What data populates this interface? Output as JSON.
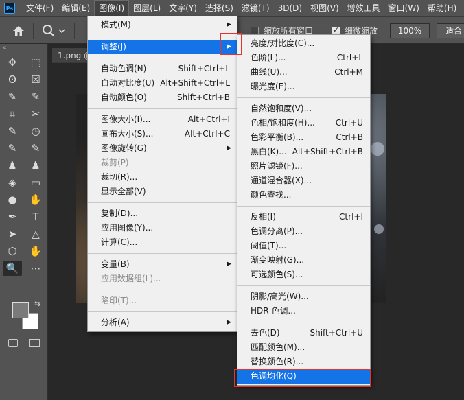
{
  "menubar": {
    "logo": "Ps",
    "items": [
      "文件(F)",
      "编辑(E)",
      "图像(I)",
      "图层(L)",
      "文字(Y)",
      "选择(S)",
      "滤镜(T)",
      "3D(D)",
      "视图(V)",
      "增效工具",
      "窗口(W)",
      "帮助(H)"
    ],
    "active_index": 2
  },
  "options": {
    "resize_all_windows": "缩放所有窗口",
    "scrubby_zoom": "细微缩放",
    "zoom_value": "100%",
    "fit_label": "适合"
  },
  "tools": {
    "header": "«",
    "icons": [
      "move-icon",
      "marquee-icon",
      "lasso-icon",
      "frame-icon",
      "quick-select-icon",
      "eyedropper-icon",
      "crop-icon",
      "patch-icon",
      "heal-icon",
      "crop-frame-icon",
      "brush-icon",
      "color-sampler-icon",
      "clone-stamp-icon",
      "history-brush-icon",
      "eraser-icon",
      "gradient-icon",
      "blur-icon",
      "dodge-icon",
      "pen-icon",
      "type-icon",
      "path-select-icon",
      "shape-icon",
      "ellipse-icon",
      "hand-icon",
      "zoom-icon",
      "more-icon"
    ],
    "glyphs": [
      "✥",
      "⬚",
      "ʘ",
      "☒",
      "✎",
      "✎",
      "⌗",
      "✂",
      "✎",
      "◷",
      "✎",
      "✎",
      "♟",
      "♟",
      "◈",
      "▭",
      "●",
      "✋",
      "✒",
      "T",
      "➤",
      "△",
      "⬡",
      "✋",
      "🔍",
      "⋯"
    ]
  },
  "document": {
    "tab": "1.png @"
  },
  "image_menu": {
    "items": [
      {
        "label": "模式(M)",
        "shortcut": "",
        "submenu": true
      },
      {
        "sep": true
      },
      {
        "label": "调整(J)",
        "shortcut": "",
        "submenu": true,
        "highlighted": true
      },
      {
        "sep": true
      },
      {
        "label": "自动色调(N)",
        "shortcut": "Shift+Ctrl+L"
      },
      {
        "label": "自动对比度(U)",
        "shortcut": "Alt+Shift+Ctrl+L"
      },
      {
        "label": "自动颜色(O)",
        "shortcut": "Shift+Ctrl+B"
      },
      {
        "sep": true
      },
      {
        "label": "图像大小(I)...",
        "shortcut": "Alt+Ctrl+I"
      },
      {
        "label": "画布大小(S)...",
        "shortcut": "Alt+Ctrl+C"
      },
      {
        "label": "图像旋转(G)",
        "shortcut": "",
        "submenu": true
      },
      {
        "label": "裁剪(P)",
        "shortcut": "",
        "disabled": true
      },
      {
        "label": "裁切(R)...",
        "shortcut": ""
      },
      {
        "label": "显示全部(V)",
        "shortcut": ""
      },
      {
        "sep": true
      },
      {
        "label": "复制(D)...",
        "shortcut": ""
      },
      {
        "label": "应用图像(Y)...",
        "shortcut": ""
      },
      {
        "label": "计算(C)...",
        "shortcut": ""
      },
      {
        "sep": true
      },
      {
        "label": "变量(B)",
        "shortcut": "",
        "submenu": true
      },
      {
        "label": "应用数据组(L)...",
        "shortcut": "",
        "disabled": true
      },
      {
        "sep": true
      },
      {
        "label": "陷印(T)...",
        "shortcut": "",
        "disabled": true
      },
      {
        "sep": true
      },
      {
        "label": "分析(A)",
        "shortcut": "",
        "submenu": true
      }
    ]
  },
  "adjust_menu": {
    "items": [
      {
        "label": "亮度/对比度(C)...",
        "shortcut": ""
      },
      {
        "label": "色阶(L)...",
        "shortcut": "Ctrl+L"
      },
      {
        "label": "曲线(U)...",
        "shortcut": "Ctrl+M"
      },
      {
        "label": "曝光度(E)...",
        "shortcut": ""
      },
      {
        "sep": true
      },
      {
        "label": "自然饱和度(V)...",
        "shortcut": ""
      },
      {
        "label": "色相/饱和度(H)...",
        "shortcut": "Ctrl+U"
      },
      {
        "label": "色彩平衡(B)...",
        "shortcut": "Ctrl+B"
      },
      {
        "label": "黑白(K)...",
        "shortcut": "Alt+Shift+Ctrl+B"
      },
      {
        "label": "照片滤镜(F)...",
        "shortcut": ""
      },
      {
        "label": "通道混合器(X)...",
        "shortcut": ""
      },
      {
        "label": "颜色查找...",
        "shortcut": ""
      },
      {
        "sep": true
      },
      {
        "label": "反相(I)",
        "shortcut": "Ctrl+I"
      },
      {
        "label": "色调分离(P)...",
        "shortcut": ""
      },
      {
        "label": "阈值(T)...",
        "shortcut": ""
      },
      {
        "label": "渐变映射(G)...",
        "shortcut": ""
      },
      {
        "label": "可选颜色(S)...",
        "shortcut": ""
      },
      {
        "sep": true
      },
      {
        "label": "阴影/高光(W)...",
        "shortcut": ""
      },
      {
        "label": "HDR 色调...",
        "shortcut": ""
      },
      {
        "sep": true
      },
      {
        "label": "去色(D)",
        "shortcut": "Shift+Ctrl+U"
      },
      {
        "label": "匹配颜色(M)...",
        "shortcut": ""
      },
      {
        "label": "替换颜色(R)...",
        "shortcut": ""
      },
      {
        "label": "色调均化(Q)",
        "shortcut": "",
        "highlighted": true
      }
    ]
  },
  "colors": {
    "highlight": "#1473e6",
    "callout": "#e8322c",
    "menu_bg": "#f0f0f0",
    "app_bg": "#282828"
  }
}
